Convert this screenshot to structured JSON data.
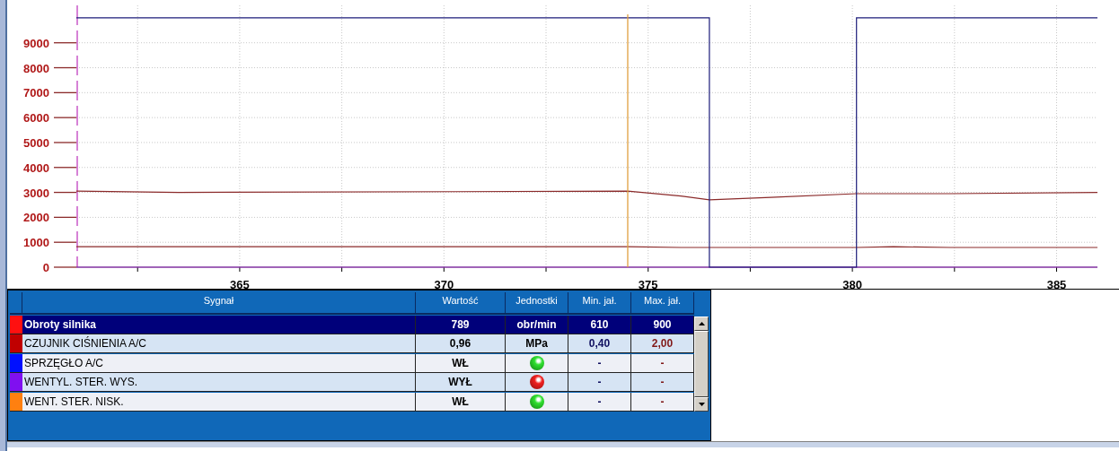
{
  "chart_data": {
    "type": "line",
    "x": [
      361,
      363.5,
      374.5,
      375.8,
      376.5,
      376.5,
      378,
      380.1,
      380.1,
      381,
      382.4,
      386
    ],
    "series": [
      {
        "color": "#8b2a2a",
        "values": [
          820,
          820,
          820,
          790,
          790,
          790,
          790,
          790,
          790,
          820,
          790,
          790
        ]
      },
      {
        "color": "#8b2a2a",
        "values": [
          3050,
          3000,
          3050,
          2850,
          2700,
          2700,
          2800,
          2950,
          2950,
          2950,
          2950,
          3000
        ]
      },
      {
        "color": "#1c1c7a",
        "values": [
          10000,
          10000,
          10000,
          10000,
          10000,
          0,
          0,
          0,
          10000,
          10000,
          10000,
          10000
        ]
      }
    ],
    "xlim": [
      361,
      386
    ],
    "ylim": [
      0,
      10500
    ],
    "xticks": [
      365,
      370,
      375,
      380,
      385
    ],
    "yticks": [
      0,
      1000,
      2000,
      3000,
      4000,
      5000,
      6000,
      7000,
      8000,
      9000
    ],
    "grid": true,
    "ref_lines": [
      {
        "axis": "x",
        "value": 374.5,
        "color": "#e0a040"
      }
    ]
  },
  "table": {
    "columns": [
      "Sygnał",
      "Wartość",
      "Jednostki",
      "Min. jał.",
      "Max. jał."
    ],
    "rows": [
      {
        "kind": "numeric",
        "color": "#ff1010",
        "signal": "Obroty silnika",
        "value": "789",
        "unit": "obr/min",
        "min": "610",
        "max": "900",
        "selected": true
      },
      {
        "kind": "numeric",
        "color": "#c00000",
        "signal": "CZUJNIK CIŚNIENIA A/C",
        "value": "0,96",
        "unit": "MPa",
        "min": "0,40",
        "max": "2,00",
        "selected": false
      },
      {
        "kind": "binary",
        "color": "#0010ff",
        "signal": "SPRZĘGŁO A/C",
        "value": "WŁ",
        "on": true,
        "min": "-",
        "max": "-",
        "selected": false
      },
      {
        "kind": "binary",
        "color": "#8010f0",
        "signal": "WENTYL. STER. WYS.",
        "value": "WYŁ",
        "on": false,
        "min": "-",
        "max": "-",
        "selected": false
      },
      {
        "kind": "binary",
        "color": "#ff8010",
        "signal": "WENT. STER. NISK.",
        "value": "WŁ",
        "on": true,
        "min": "-",
        "max": "-",
        "selected": false
      }
    ]
  }
}
